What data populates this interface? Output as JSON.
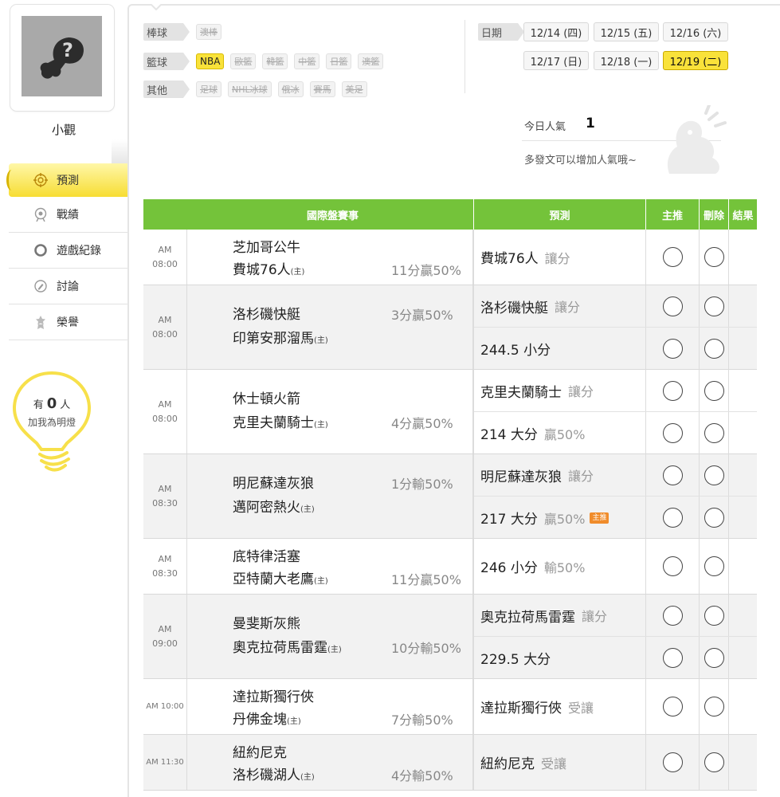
{
  "user": {
    "name": "小觀"
  },
  "nav": [
    {
      "label": "預測",
      "icon": "target-icon",
      "active": true
    },
    {
      "label": "戰績",
      "icon": "record-icon",
      "active": false
    },
    {
      "label": "遊戲紀錄",
      "icon": "circle-icon",
      "active": false
    },
    {
      "label": "討論",
      "icon": "discuss-icon",
      "active": false
    },
    {
      "label": "榮譽",
      "icon": "medal-icon",
      "active": false
    }
  ],
  "bulb": {
    "prefix": "有",
    "count": "0",
    "suffix": "人",
    "text": "加我為明燈"
  },
  "filters": {
    "baseball": {
      "label": "棒球",
      "tags": [
        "澳棒"
      ]
    },
    "basketball": {
      "label": "籃球",
      "tags": [
        "NBA",
        "歐籃",
        "韓籃",
        "中籃",
        "日籃",
        "澳籃"
      ],
      "active": "NBA"
    },
    "other": {
      "label": "其他",
      "tags": [
        "足球",
        "NHL冰球",
        "俄冰",
        "賽馬",
        "美足"
      ]
    }
  },
  "dates": {
    "label": "日期",
    "items": [
      "12/14 (四)",
      "12/15 (五)",
      "12/16 (六)",
      "12/17 (日)",
      "12/18 (一)",
      "12/19 (二)"
    ],
    "active": "12/19 (二)"
  },
  "popularity": {
    "label": "今日人氣",
    "value": "1",
    "tip": "多發文可以增加人氣哦~"
  },
  "table": {
    "headers": {
      "game": "國際盤賽事",
      "pred": "預測",
      "zhu": "主推",
      "del": "刪除",
      "res": "結果"
    },
    "home_mark": "(主)",
    "groups": [
      {
        "time": "AM 08:00",
        "team1": "芝加哥公牛",
        "team2": "費城76人",
        "handicap": "11分贏50%",
        "handicap_row": 2,
        "preds": [
          {
            "pick": "費城76人",
            "note": "讓分"
          }
        ]
      },
      {
        "time": "AM 08:00",
        "team1": "洛杉磯快艇",
        "team2": "印第安那溜馬",
        "handicap": "3分贏50%",
        "handicap_row": 1,
        "preds": [
          {
            "pick": "洛杉磯快艇",
            "note": "讓分"
          },
          {
            "pick": "244.5 小分",
            "note": ""
          }
        ]
      },
      {
        "time": "AM 08:00",
        "team1": "休士頓火箭",
        "team2": "克里夫蘭騎士",
        "handicap": "4分贏50%",
        "handicap_row": 2,
        "preds": [
          {
            "pick": "克里夫蘭騎士",
            "note": "讓分"
          },
          {
            "pick": "214 大分",
            "note": "贏50%"
          }
        ]
      },
      {
        "time": "AM 08:30",
        "team1": "明尼蘇達灰狼",
        "team2": "邁阿密熱火",
        "handicap": "1分輸50%",
        "handicap_row": 1,
        "preds": [
          {
            "pick": "明尼蘇達灰狼",
            "note": "讓分"
          },
          {
            "pick": "217 大分",
            "note": "贏50%",
            "badge": "主推"
          }
        ]
      },
      {
        "time": "AM 08:30",
        "team1": "底特律活塞",
        "team2": "亞特蘭大老鷹",
        "handicap": "11分贏50%",
        "handicap_row": 2,
        "preds": [
          {
            "pick": "246 小分",
            "note": "輸50%"
          }
        ]
      },
      {
        "time": "AM 09:00",
        "team1": "曼斐斯灰熊",
        "team2": "奧克拉荷馬雷霆",
        "handicap": "10分輸50%",
        "handicap_row": 2,
        "preds": [
          {
            "pick": "奧克拉荷馬雷霆",
            "note": "讓分"
          },
          {
            "pick": "229.5 大分",
            "note": ""
          }
        ]
      },
      {
        "time": "AM 10:00",
        "team1": "達拉斯獨行俠",
        "team2": "丹佛金塊",
        "handicap": "7分輸50%",
        "handicap_row": 2,
        "preds": [
          {
            "pick": "達拉斯獨行俠",
            "note": "受讓"
          }
        ]
      },
      {
        "time": "AM 11:30",
        "team1": "紐約尼克",
        "team2": "洛杉磯湖人",
        "handicap": "4分輸50%",
        "handicap_row": 2,
        "preds": [
          {
            "pick": "紐約尼克",
            "note": "受讓"
          }
        ]
      }
    ]
  },
  "colors": {
    "accent_green": "#74c33a",
    "highlight_yellow": "#f9e23a",
    "badge_orange": "#f08c2b"
  }
}
